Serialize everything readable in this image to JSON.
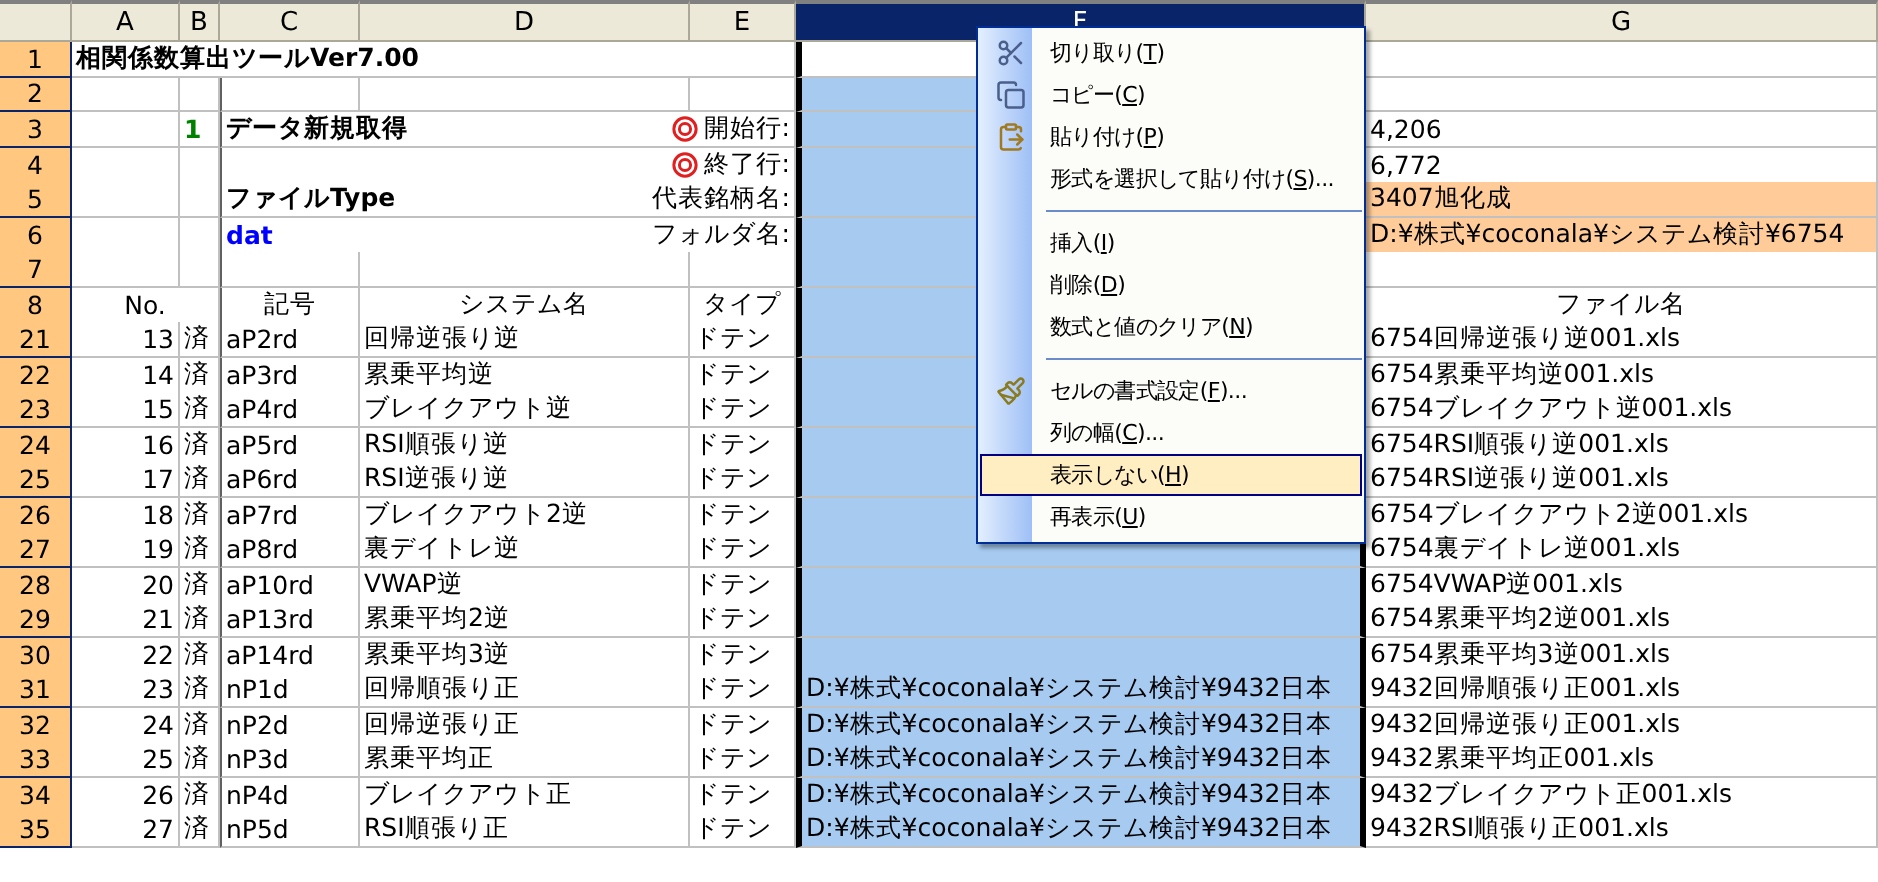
{
  "columns": [
    {
      "label": "A",
      "selected": false
    },
    {
      "label": "B",
      "selected": false
    },
    {
      "label": "C",
      "selected": false
    },
    {
      "label": "D",
      "selected": false
    },
    {
      "label": "E",
      "selected": false
    },
    {
      "label": "F",
      "selected": true
    },
    {
      "label": "G",
      "selected": false
    }
  ],
  "rows": [
    {
      "num": "1",
      "kind": "top",
      "cells": [
        {
          "text": "相関係数算出ツールVer7.00",
          "kind": "bold"
        },
        null,
        null,
        null,
        null,
        {
          "kind": "active"
        },
        null
      ]
    },
    {
      "num": "2",
      "kind": "top",
      "cells": [
        null,
        null,
        null,
        null,
        null,
        null,
        null
      ]
    },
    {
      "num": "3",
      "kind": "top",
      "cells": [
        null,
        {
          "text": "1",
          "kind": "green"
        },
        {
          "text": "データ新規取得",
          "kind": "bold"
        },
        null,
        {
          "text": "開始行:",
          "kind": "marked"
        },
        null,
        "4,206"
      ]
    },
    {
      "num": "4",
      "kind": "top",
      "cells": [
        null,
        null,
        null,
        null,
        {
          "text": "終了行:",
          "kind": "marked"
        },
        null,
        "6,772"
      ]
    },
    {
      "num": "5",
      "kind": "top",
      "cells": [
        null,
        null,
        {
          "text": "ファイルType",
          "kind": "bold"
        },
        null,
        "代表銘柄名:",
        null,
        {
          "text": "3407旭化成",
          "kind": "shaded"
        }
      ]
    },
    {
      "num": "6",
      "kind": "top",
      "cells": [
        null,
        null,
        {
          "text": "dat",
          "kind": "blue"
        },
        null,
        "フォルダ名:",
        null,
        {
          "text": "D:¥株式¥coconala¥システム検討¥6754",
          "kind": "shaded"
        }
      ]
    },
    {
      "num": "7",
      "kind": "top",
      "cells": [
        null,
        null,
        null,
        null,
        null,
        null,
        null
      ]
    },
    {
      "num": "8",
      "kind": "header",
      "cells": [
        "No.",
        null,
        "記号",
        "システム名",
        "タイプ",
        null,
        "ファイル名"
      ]
    },
    {
      "num": "21",
      "kind": "data",
      "cells": [
        "13",
        "済",
        "aP2rd",
        "回帰逆張り逆",
        "ドテン",
        null,
        "6754回帰逆張り逆001.xls"
      ]
    },
    {
      "num": "22",
      "kind": "data",
      "cells": [
        "14",
        "済",
        "aP3rd",
        "累乗平均逆",
        "ドテン",
        null,
        "6754累乗平均逆001.xls"
      ]
    },
    {
      "num": "23",
      "kind": "data",
      "cells": [
        "15",
        "済",
        "aP4rd",
        "ブレイクアウト逆",
        "ドテン",
        null,
        "6754ブレイクアウト逆001.xls"
      ]
    },
    {
      "num": "24",
      "kind": "data",
      "cells": [
        "16",
        "済",
        "aP5rd",
        "RSI順張り逆",
        "ドテン",
        null,
        "6754RSI順張り逆001.xls"
      ]
    },
    {
      "num": "25",
      "kind": "data",
      "cells": [
        "17",
        "済",
        "aP6rd",
        "RSI逆張り逆",
        "ドテン",
        null,
        "6754RSI逆張り逆001.xls"
      ]
    },
    {
      "num": "26",
      "kind": "data",
      "cells": [
        "18",
        "済",
        "aP7rd",
        "ブレイクアウト2逆",
        "ドテン",
        null,
        "6754ブレイクアウト2逆001.xls"
      ]
    },
    {
      "num": "27",
      "kind": "data",
      "cells": [
        "19",
        "済",
        "aP8rd",
        "裏デイトレ逆",
        "ドテン",
        null,
        "6754裏デイトレ逆001.xls"
      ]
    },
    {
      "num": "28",
      "kind": "data",
      "cells": [
        "20",
        "済",
        "aP10rd",
        "VWAP逆",
        "ドテン",
        null,
        "6754VWAP逆001.xls"
      ]
    },
    {
      "num": "29",
      "kind": "data",
      "cells": [
        "21",
        "済",
        "aP13rd",
        "累乗平均2逆",
        "ドテン",
        null,
        "6754累乗平均2逆001.xls"
      ]
    },
    {
      "num": "30",
      "kind": "data",
      "cells": [
        "22",
        "済",
        "aP14rd",
        "累乗平均3逆",
        "ドテン",
        null,
        "6754累乗平均3逆001.xls"
      ]
    },
    {
      "num": "31",
      "kind": "data",
      "cells": [
        "23",
        "済",
        "nP1d",
        "回帰順張り正",
        "ドテン",
        "D:¥株式¥coconala¥システム検討¥9432日本",
        "9432回帰順張り正001.xls"
      ]
    },
    {
      "num": "32",
      "kind": "data",
      "cells": [
        "24",
        "済",
        "nP2d",
        "回帰逆張り正",
        "ドテン",
        "D:¥株式¥coconala¥システム検討¥9432日本",
        "9432回帰逆張り正001.xls"
      ]
    },
    {
      "num": "33",
      "kind": "data",
      "cells": [
        "25",
        "済",
        "nP3d",
        "累乗平均正",
        "ドテン",
        "D:¥株式¥coconala¥システム検討¥9432日本",
        "9432累乗平均正001.xls"
      ]
    },
    {
      "num": "34",
      "kind": "data",
      "cells": [
        "26",
        "済",
        "nP4d",
        "ブレイクアウト正",
        "ドテン",
        "D:¥株式¥coconala¥システム検討¥9432日本",
        "9432ブレイクアウト正001.xls"
      ]
    },
    {
      "num": "35",
      "kind": "data",
      "cells": [
        "27",
        "済",
        "nP5d",
        "RSI順張り正",
        "ドテン",
        "D:¥株式¥coconala¥システム検討¥9432日本",
        "9432RSI順張り正001.xls"
      ]
    }
  ],
  "context_menu": {
    "groups": [
      [
        {
          "before": "切り取り(",
          "accel": "T",
          "after": ")",
          "selected": false
        },
        {
          "before": "コピー(",
          "accel": "C",
          "after": ")",
          "selected": false
        },
        {
          "before": "貼り付け(",
          "accel": "P",
          "after": ")",
          "selected": false
        },
        {
          "before": "形式を選択して貼り付け(",
          "accel": "S",
          "after": ")...",
          "selected": false
        }
      ],
      [
        {
          "before": "挿入(",
          "accel": "I",
          "after": ")",
          "selected": false
        },
        {
          "before": "削除(",
          "accel": "D",
          "after": ")",
          "selected": false
        },
        {
          "before": "数式と値のクリア(",
          "accel": "N",
          "after": ")",
          "selected": false
        }
      ],
      [
        {
          "before": "セルの書式設定(",
          "accel": "F",
          "after": ")...",
          "selected": false
        },
        {
          "before": "列の幅(",
          "accel": "C",
          "after": ")...",
          "selected": false
        },
        {
          "before": "表示しない(",
          "accel": "H",
          "after": ")",
          "selected": true
        },
        {
          "before": "再表示(",
          "accel": "U",
          "after": ")",
          "selected": false
        }
      ]
    ]
  }
}
